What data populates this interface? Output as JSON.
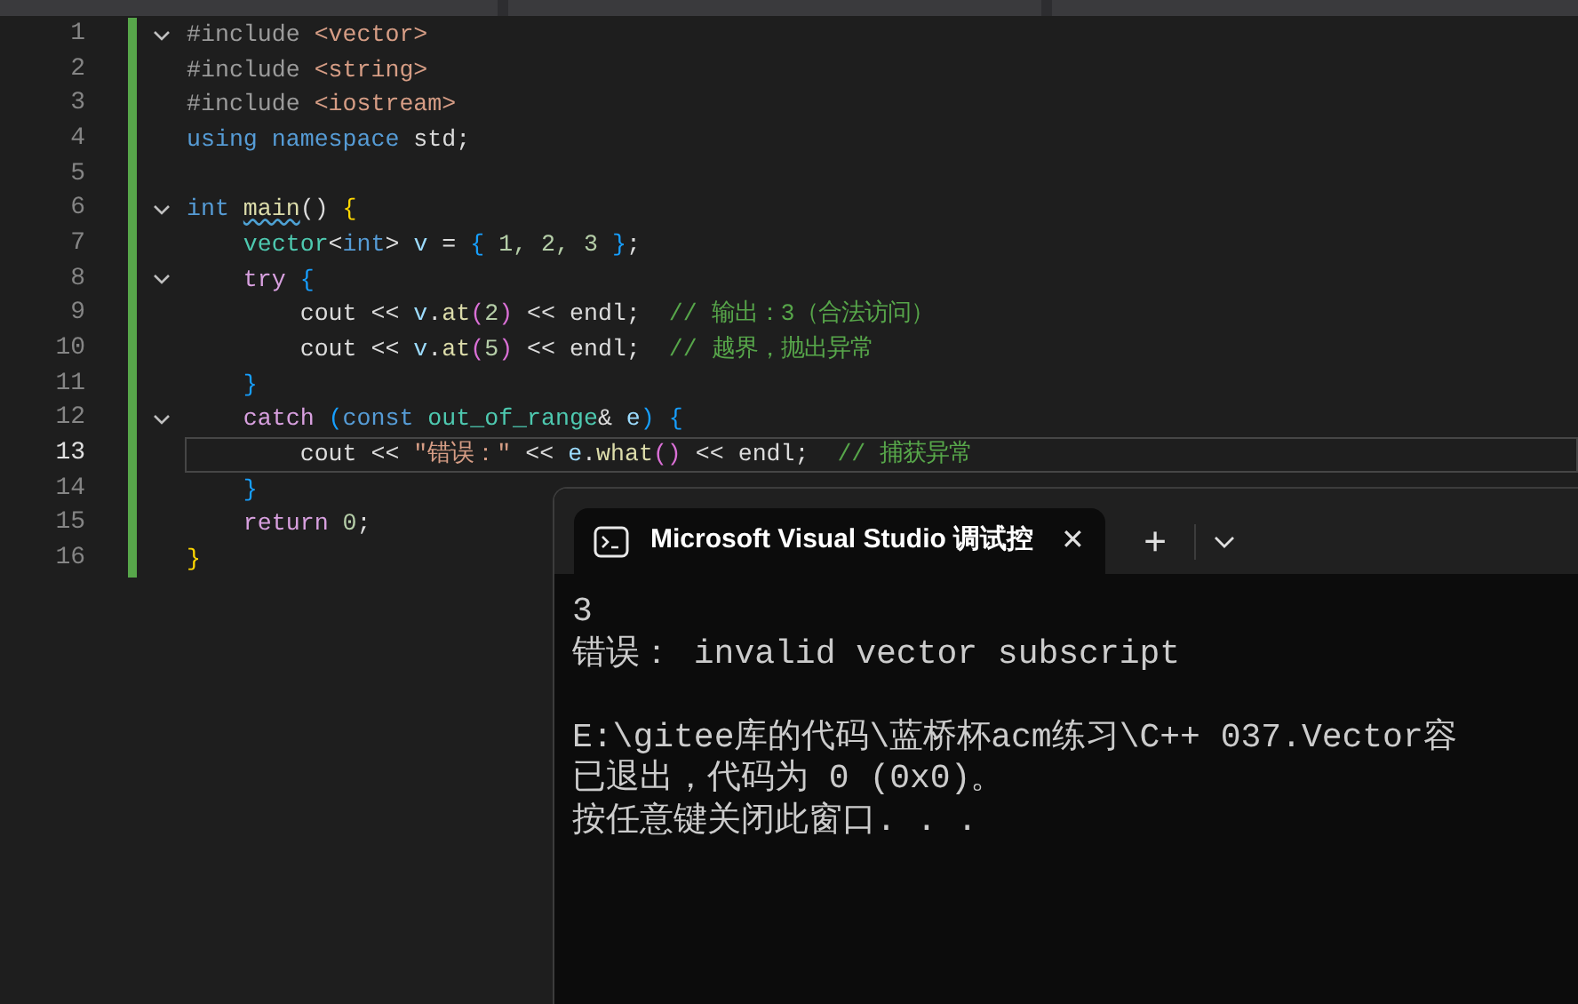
{
  "editor": {
    "lines": [
      {
        "number": "1",
        "fold": true,
        "current": false,
        "tokens": [
          {
            "text": "#include ",
            "kind": "pre"
          },
          {
            "text": "<vector>",
            "kind": "str"
          }
        ]
      },
      {
        "number": "2",
        "fold": false,
        "current": false,
        "tokens": [
          {
            "text": "#include ",
            "kind": "pre"
          },
          {
            "text": "<string>",
            "kind": "str"
          }
        ]
      },
      {
        "number": "3",
        "fold": false,
        "current": false,
        "tokens": [
          {
            "text": "#include ",
            "kind": "pre"
          },
          {
            "text": "<iostream>",
            "kind": "str"
          }
        ]
      },
      {
        "number": "4",
        "fold": false,
        "current": false,
        "tokens": [
          {
            "text": "using namespace ",
            "kind": "kw"
          },
          {
            "text": "std;",
            "kind": "plain"
          }
        ]
      },
      {
        "number": "5",
        "fold": false,
        "current": false
      },
      {
        "number": "6",
        "fold": true,
        "current": false,
        "tokens": [
          {
            "text": "int ",
            "kind": "kw"
          },
          {
            "text": "main",
            "kind": "fnwarn"
          },
          {
            "text": "() ",
            "kind": "plain"
          },
          {
            "text": "{",
            "kind": "brace1"
          }
        ]
      },
      {
        "number": "7",
        "fold": false,
        "current": false,
        "tokens": [
          {
            "text": "    vector",
            "kind": "type"
          },
          {
            "text": "<",
            "kind": "plain"
          },
          {
            "text": "int",
            "kind": "kw"
          },
          {
            "text": "> ",
            "kind": "plain"
          },
          {
            "text": "v",
            "kind": "var"
          },
          {
            "text": " = ",
            "kind": "plain"
          },
          {
            "text": "{",
            "kind": "brace2"
          },
          {
            "text": " 1, 2, 3 ",
            "kind": "num"
          },
          {
            "text": "}",
            "kind": "brace2"
          },
          {
            "text": ";",
            "kind": "plain"
          }
        ]
      },
      {
        "number": "8",
        "fold": true,
        "current": false,
        "tokens": [
          {
            "text": "    try ",
            "kind": "ctrl"
          },
          {
            "text": "{",
            "kind": "brace2"
          }
        ]
      },
      {
        "number": "9",
        "fold": false,
        "current": false,
        "tokens": [
          {
            "text": "        cout << ",
            "kind": "plain"
          },
          {
            "text": "v",
            "kind": "var"
          },
          {
            "text": ".",
            "kind": "plain"
          },
          {
            "text": "at",
            "kind": "fn"
          },
          {
            "text": "(",
            "kind": "brace3"
          },
          {
            "text": "2",
            "kind": "num"
          },
          {
            "text": ")",
            "kind": "brace3"
          },
          {
            "text": " << endl;  ",
            "kind": "plain"
          },
          {
            "text": "// 输出：3（合法访问）",
            "kind": "comment"
          }
        ]
      },
      {
        "number": "10",
        "fold": false,
        "current": false,
        "tokens": [
          {
            "text": "        cout << ",
            "kind": "plain"
          },
          {
            "text": "v",
            "kind": "var"
          },
          {
            "text": ".",
            "kind": "plain"
          },
          {
            "text": "at",
            "kind": "fn"
          },
          {
            "text": "(",
            "kind": "brace3"
          },
          {
            "text": "5",
            "kind": "num"
          },
          {
            "text": ")",
            "kind": "brace3"
          },
          {
            "text": " << endl;  ",
            "kind": "plain"
          },
          {
            "text": "// 越界，抛出异常",
            "kind": "comment"
          }
        ]
      },
      {
        "number": "11",
        "fold": false,
        "current": false,
        "tokens": [
          {
            "text": "    }",
            "kind": "brace2"
          }
        ]
      },
      {
        "number": "12",
        "fold": true,
        "current": false,
        "tokens": [
          {
            "text": "    catch ",
            "kind": "ctrl"
          },
          {
            "text": "(",
            "kind": "brace2"
          },
          {
            "text": "const ",
            "kind": "kw"
          },
          {
            "text": "out_of_range",
            "kind": "type"
          },
          {
            "text": "& ",
            "kind": "plain"
          },
          {
            "text": "e",
            "kind": "var"
          },
          {
            "text": ") ",
            "kind": "brace2"
          },
          {
            "text": "{",
            "kind": "brace2"
          }
        ]
      },
      {
        "number": "13",
        "fold": false,
        "current": true,
        "tokens": [
          {
            "text": "        cout << ",
            "kind": "plain"
          },
          {
            "text": "\"错误：\"",
            "kind": "str"
          },
          {
            "text": " << ",
            "kind": "plain"
          },
          {
            "text": "e",
            "kind": "var"
          },
          {
            "text": ".",
            "kind": "plain"
          },
          {
            "text": "what",
            "kind": "fn"
          },
          {
            "text": "()",
            "kind": "brace3"
          },
          {
            "text": " << endl;  ",
            "kind": "plain"
          },
          {
            "text": "// 捕获异常",
            "kind": "comment"
          }
        ]
      },
      {
        "number": "14",
        "fold": false,
        "current": false,
        "tokens": [
          {
            "text": "    }",
            "kind": "brace2"
          }
        ]
      },
      {
        "number": "15",
        "fold": false,
        "current": false,
        "tokens": [
          {
            "text": "    return ",
            "kind": "ctrl"
          },
          {
            "text": "0",
            "kind": "num"
          },
          {
            "text": ";",
            "kind": "plain"
          }
        ]
      },
      {
        "number": "16",
        "fold": false,
        "current": false,
        "tokens": [
          {
            "text": "}",
            "kind": "brace1"
          }
        ]
      }
    ]
  },
  "terminal": {
    "tab": {
      "title": "Microsoft Visual Studio 调试控",
      "close": "✕",
      "selected": true
    },
    "new_tab": "+",
    "output_blocks": [
      [
        "3",
        "错误： invalid vector subscript"
      ],
      [
        "E:\\gitee库的代码\\蓝桥杯acm练习\\C++ 037.Vector容",
        "已退出，代码为 0 (0x0)。",
        "按任意键关闭此窗口. . ."
      ]
    ]
  }
}
